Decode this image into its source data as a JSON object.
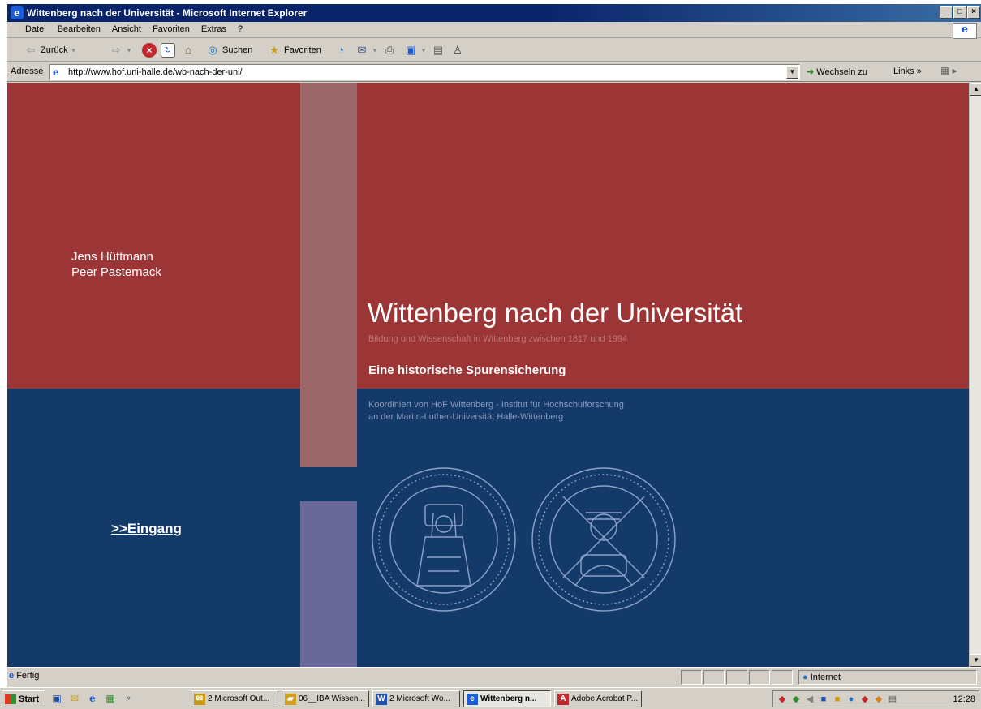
{
  "window": {
    "title": "Wittenberg nach der Universität - Microsoft Internet Explorer",
    "buttons": [
      "_",
      "□",
      "×"
    ]
  },
  "menu": {
    "items": [
      "Datei",
      "Bearbeiten",
      "Ansicht",
      "Favoriten",
      "Extras",
      "?"
    ]
  },
  "toolbar": {
    "back_label": "Zurück",
    "search_label": "Suchen",
    "favorites_label": "Favoriten"
  },
  "address": {
    "label": "Adresse",
    "url": "http://www.hof.uni-halle.de/wb-nach-der-uni/",
    "go_label": "Wechseln zu",
    "links_label": "Links »"
  },
  "page": {
    "authors": [
      "Jens Hüttmann",
      "Peer Pasternack"
    ],
    "title": "Wittenberg nach der Universität",
    "subtitle": "Bildung und Wissenschaft in Wittenberg zwischen 1817 und 1994",
    "tagline": "Eine historische Spurensicherung",
    "coordination": [
      "Koordiniert von HoF Wittenberg - Institut für Hochschulforschung",
      "an der Martin-Luther-Universität Halle-Wittenberg"
    ],
    "entry_link": ">>Eingang",
    "colors": {
      "red_band": "#9b3536",
      "blue_band": "#143a6a",
      "pillar_top": "#9b6768",
      "pillar_bottom": "#6a6898"
    }
  },
  "status": {
    "left": "Fertig",
    "zone": "Internet"
  },
  "taskbar": {
    "start": "Start",
    "tasks": [
      "2 Microsoft Out...",
      "06__IBA Wissen...",
      "2 Microsoft Wo...",
      "Wittenberg n...",
      "Adobe Acrobat P..."
    ],
    "clock": "12:28"
  }
}
